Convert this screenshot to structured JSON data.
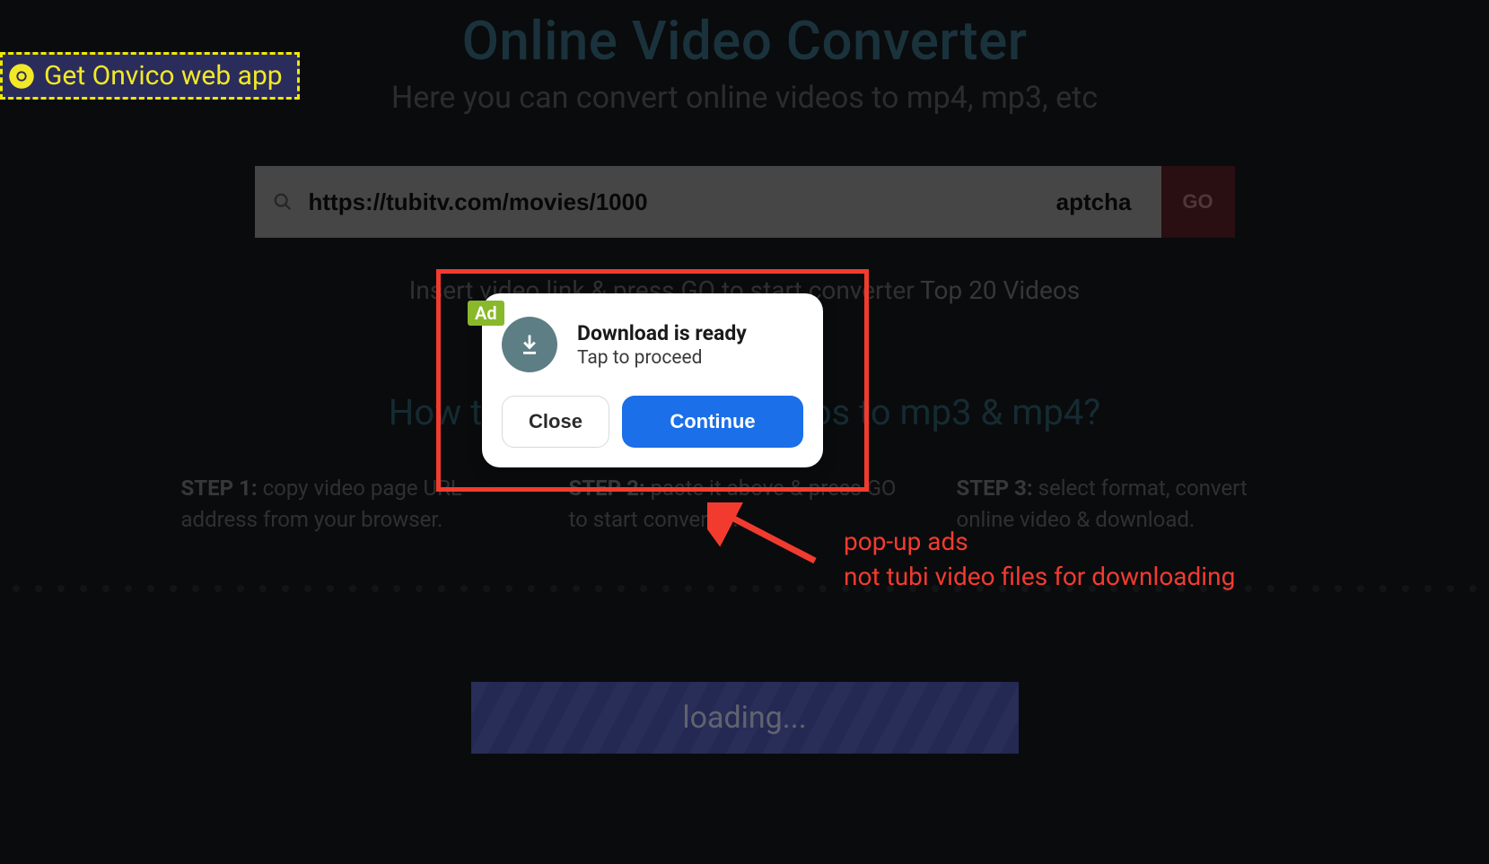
{
  "webapp_badge": "Get Onvico web app",
  "header": {
    "title": "Online Video Converter",
    "subtitle": "Here you can convert online videos to mp4, mp3, etc"
  },
  "search": {
    "value": "https://tubitv.com/movies/1000                                                               aptcha",
    "go": "GO"
  },
  "hint": {
    "text": "Insert video link & press GO to start converter ",
    "link": "Top 20 Videos"
  },
  "howto": {
    "title": "How to convert online videos to mp3 & mp4?",
    "steps": [
      {
        "label": "STEP 1:",
        "text": " copy video page URL address from your browser."
      },
      {
        "label": "STEP 2:",
        "text": " paste it above & press GO to start converter."
      },
      {
        "label": "STEP 3:",
        "text": " select format, convert online video & download."
      }
    ]
  },
  "loading": "loading...",
  "popup": {
    "ad_tag": "Ad",
    "title": "Download is ready",
    "subtitle": "Tap to proceed",
    "close": "Close",
    "continue": "Continue"
  },
  "annotation": {
    "line1": "pop-up ads",
    "line2": "not tubi video files for downloading"
  }
}
